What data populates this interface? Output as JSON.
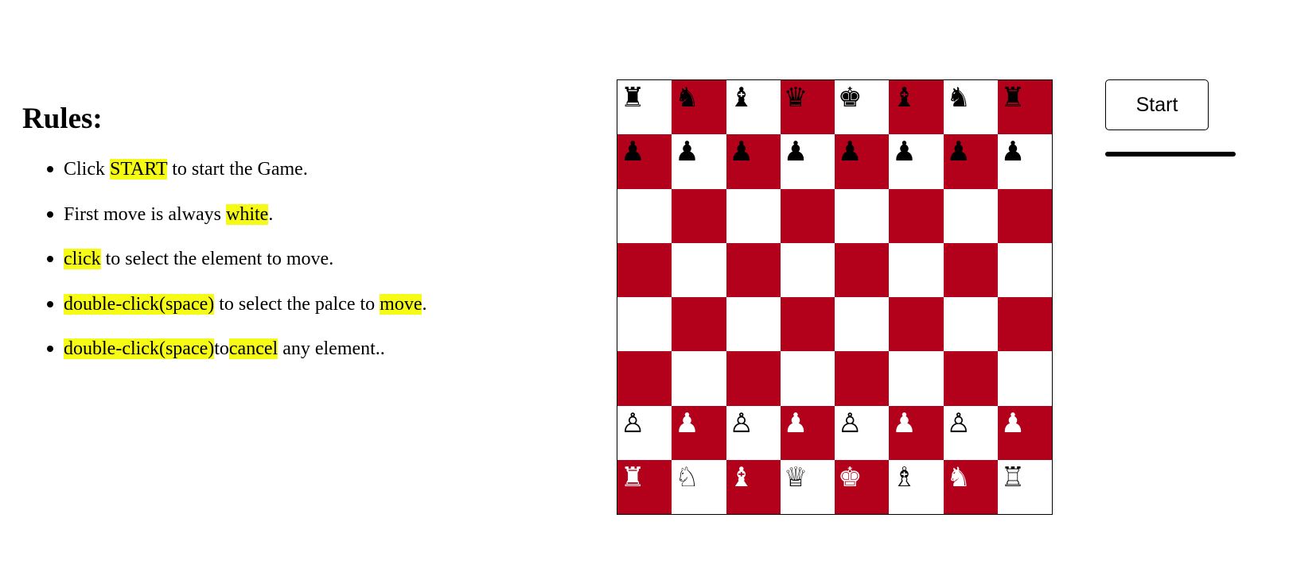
{
  "rules": {
    "title": "Rules:",
    "items": [
      [
        {
          "t": "Click ",
          "h": false
        },
        {
          "t": "START",
          "h": true
        },
        {
          "t": " to start the Game.",
          "h": false
        }
      ],
      [
        {
          "t": "First move is always ",
          "h": false
        },
        {
          "t": "white",
          "h": true
        },
        {
          "t": ".",
          "h": false
        }
      ],
      [
        {
          "t": "click",
          "h": true
        },
        {
          "t": " to select the element to move.",
          "h": false
        }
      ],
      [
        {
          "t": "double-click(space)",
          "h": true
        },
        {
          "t": " to select the palce to ",
          "h": false
        },
        {
          "t": "move",
          "h": true
        },
        {
          "t": ".",
          "h": false
        }
      ],
      [
        {
          "t": "double-click(space)",
          "h": true
        },
        {
          "t": "to",
          "h": false
        },
        {
          "t": "cancel",
          "h": true
        },
        {
          "t": " any element..",
          "h": false
        }
      ]
    ]
  },
  "colors": {
    "highlight": "#f5fb14",
    "dark_square": "#b3001b",
    "light_square": "#ffffff"
  },
  "board": {
    "rows": [
      [
        "bR",
        "bN",
        "bB",
        "bQ",
        "bK",
        "bB",
        "bN",
        "bR"
      ],
      [
        "bP",
        "bP",
        "bP",
        "bP",
        "bP",
        "bP",
        "bP",
        "bP"
      ],
      [
        "",
        "",
        "",
        "",
        "",
        "",
        "",
        ""
      ],
      [
        "",
        "",
        "",
        "",
        "",
        "",
        "",
        ""
      ],
      [
        "",
        "",
        "",
        "",
        "",
        "",
        "",
        ""
      ],
      [
        "",
        "",
        "",
        "",
        "",
        "",
        "",
        ""
      ],
      [
        "wP",
        "wP",
        "wP",
        "wP",
        "wP",
        "wP",
        "wP",
        "wP"
      ],
      [
        "wR",
        "wN",
        "wB",
        "wQ",
        "wK",
        "wB",
        "wN",
        "wR"
      ]
    ]
  },
  "controls": {
    "start_label": "Start"
  }
}
